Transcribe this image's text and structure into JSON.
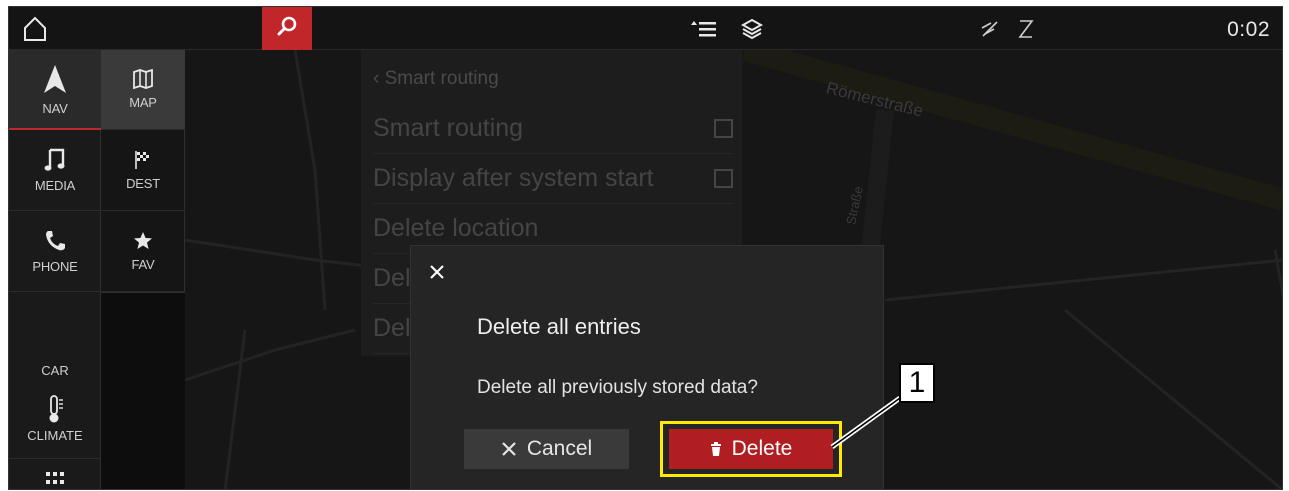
{
  "topbar": {
    "home_icon": "home-icon",
    "search_icon": "search-icon",
    "list_icon": "route-list-icon",
    "layers_icon": "layers-icon",
    "nomap_icon": "map-offline-icon",
    "phone_off_icon": "phone-off-icon",
    "time": "0:02",
    "accent_color": "#c0262a"
  },
  "sidebar": {
    "items": [
      {
        "label": "NAV",
        "icon": "navigation-arrow-icon",
        "active": true
      },
      {
        "label": "MEDIA",
        "icon": "music-note-icon"
      },
      {
        "label": "PHONE",
        "icon": "phone-icon"
      },
      {
        "label": "CAR"
      },
      {
        "label": "CLIMATE",
        "icon": "thermometer-icon"
      },
      {
        "icon": "apps-grid-icon"
      }
    ],
    "sub_items": [
      {
        "label": "MAP",
        "icon": "map-icon",
        "active": true
      },
      {
        "label": "DEST",
        "icon": "checkered-flag-icon"
      },
      {
        "label": "FAV",
        "icon": "star-icon"
      }
    ]
  },
  "map": {
    "street_1": "Römerstraße",
    "street_2": "Straße"
  },
  "settings": {
    "back_label": "‹ Smart routing",
    "rows": [
      {
        "label": "Smart routing"
      },
      {
        "label": "Display after system start"
      },
      {
        "label": "Delete location"
      },
      {
        "label": "Del"
      },
      {
        "label": "Del"
      }
    ]
  },
  "dialog": {
    "title": "Delete all entries",
    "message": "Delete all previously stored data?",
    "cancel_label": "Cancel",
    "delete_label": "Delete",
    "highlight_color": "#ffea00",
    "delete_color": "#b01e22"
  },
  "callout": {
    "number": "1"
  }
}
